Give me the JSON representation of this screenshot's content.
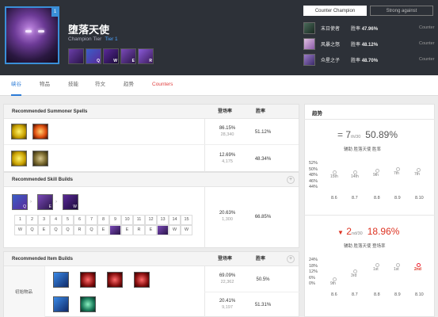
{
  "champion": {
    "name": "堕落天使",
    "tier_label": "Champion Tier",
    "tier_value": "Tier 1",
    "badge": "1",
    "skill_keys": [
      "",
      "Q",
      "W",
      "E",
      "R"
    ]
  },
  "counter_tabs": [
    "Counter Champion",
    "Strong against"
  ],
  "counters": [
    {
      "name": "末日使者",
      "rate_label": "胜率",
      "rate": "47.96%",
      "link": "Counter",
      "color": "#3a5a4a"
    },
    {
      "name": "风暴之怒",
      "rate_label": "胜率",
      "rate": "48.12%",
      "link": "Counter",
      "color": "#c8a0c8"
    },
    {
      "name": "众星之子",
      "rate_label": "胜率",
      "rate": "48.70%",
      "link": "Counter",
      "color": "#7a5aa8"
    }
  ],
  "nav": [
    "峡谷",
    "物品",
    "技能",
    "符文",
    "趋势",
    "Counters"
  ],
  "summoner": {
    "title": "Recommended Summoner Spells",
    "col1": "登场率",
    "col2": "胜率",
    "rows": [
      {
        "pick": "86.15%",
        "games": "28,340",
        "win": "51.12%"
      },
      {
        "pick": "12.69%",
        "games": "4,175",
        "win": "48.34%"
      }
    ]
  },
  "skill_builds": {
    "title": "Recommended Skill Builds",
    "col1": "登场率",
    "col2": "胜率",
    "pick": "20.63%",
    "games": "1,300",
    "win": "66.85%",
    "order_keys": [
      "Q",
      "E",
      "W"
    ],
    "levels": [
      "1",
      "2",
      "3",
      "4",
      "5",
      "6",
      "7",
      "8",
      "9",
      "10",
      "11",
      "12",
      "13",
      "14",
      "15"
    ],
    "sequence": [
      "W",
      "Q",
      "E",
      "Q",
      "Q",
      "R",
      "Q",
      "E",
      "",
      "E",
      "R",
      "E",
      "",
      "W",
      "W"
    ]
  },
  "item_builds": {
    "title": "Recommended Item Builds",
    "col1": "登场率",
    "col2": "胜率",
    "label": "初始物品",
    "rows": [
      {
        "pick": "69.09%",
        "games": "22,362",
        "win": "50.5%"
      },
      {
        "pick": "20.41%",
        "games": "9,197",
        "win": "51.31%"
      }
    ]
  },
  "trend": {
    "title": "趋势",
    "block1": {
      "prefix": "=",
      "rank": "7",
      "suffix": "th",
      "of": "/30",
      "pct": "50.89%",
      "sub": "辅助 胜落天使 胜率",
      "yticks": [
        "52%",
        "50%",
        "48%",
        "46%",
        "44%"
      ],
      "point_labels": [
        "15th",
        "14th",
        "9th",
        "7th",
        "7th"
      ],
      "point_values": [
        49.2,
        49.0,
        49.6,
        50.2,
        50.0
      ]
    },
    "block2": {
      "prefix": "▼",
      "rank": "2",
      "suffix": "nd",
      "of": "/30",
      "pct": "18.96%",
      "sub": "辅助 胜落天使 登场率",
      "yticks": [
        "24%",
        "18%",
        "12%",
        "6%",
        "0%"
      ],
      "point_labels": [
        "9th",
        "3rd",
        "1st",
        "1st",
        "2nd"
      ],
      "point_values": [
        4.5,
        13.0,
        19.0,
        19.5,
        18.96
      ]
    },
    "versions": [
      "8.6",
      "8.7",
      "8.8",
      "8.9",
      "8.10"
    ]
  }
}
